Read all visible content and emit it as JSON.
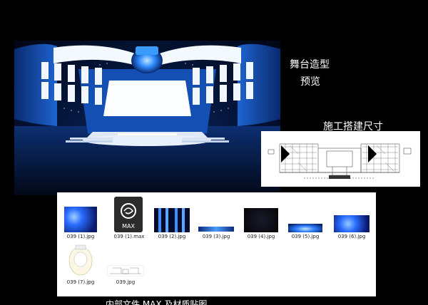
{
  "captions": {
    "stage_line1": "舞台造型",
    "stage_line2": "预览",
    "construction": "施工搭建尺寸",
    "bottom": "内部文件 MAX 及材质贴图"
  },
  "files": [
    {
      "name": "039 (1).jpg",
      "icon": "blue-light-image-icon"
    },
    {
      "name": "039 (1).max",
      "icon": "3ds-max-file-icon",
      "badge": "MAX"
    },
    {
      "name": "039 (2).jpg",
      "icon": "blue-pillars-image-icon"
    },
    {
      "name": "039 (3).jpg",
      "icon": "blue-strip-image-icon"
    },
    {
      "name": "039 (4).jpg",
      "icon": "dark-stars-image-icon"
    },
    {
      "name": "039 (5).jpg",
      "icon": "blue-glow-image-icon"
    },
    {
      "name": "039 (6).jpg",
      "icon": "blue-sparkle-image-icon"
    },
    {
      "name": "039 (7).jpg",
      "icon": "floor-plan-image-icon"
    },
    {
      "name": "039.jpg",
      "icon": "elevation-drawing-image-icon"
    }
  ],
  "colors": {
    "background": "#000000",
    "stage_blue": "#1a5cc8",
    "screen_white": "#ffffff",
    "panel_white": "#ffffff"
  }
}
